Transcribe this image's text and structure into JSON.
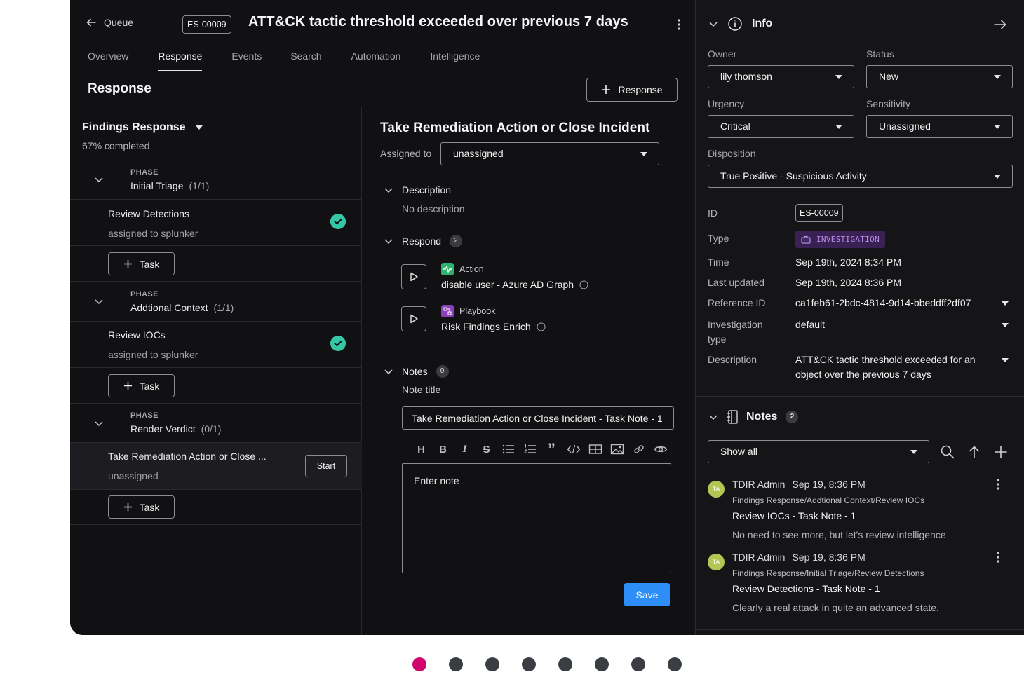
{
  "header": {
    "back_label": "Queue",
    "case_id": "ES-00009",
    "title": "ATT&CK tactic threshold exceeded over previous 7 days",
    "tabs": [
      {
        "label": "Overview"
      },
      {
        "label": "Response",
        "active": true
      },
      {
        "label": "Events"
      },
      {
        "label": "Search"
      },
      {
        "label": "Automation"
      },
      {
        "label": "Intelligence"
      }
    ]
  },
  "response": {
    "title": "Response",
    "add_button": "Response"
  },
  "findings": {
    "title": "Findings Response",
    "progress": "67% completed",
    "phases": [
      {
        "kicker": "PHASE",
        "name": "Initial Triage",
        "count": "(1/1)",
        "task": {
          "name": "Review Detections",
          "assignee": "assigned to splunker",
          "done": true
        }
      },
      {
        "kicker": "PHASE",
        "name": "Addtional Context",
        "count": "(1/1)",
        "task": {
          "name": "Review IOCs",
          "assignee": "assigned to splunker",
          "done": true
        }
      },
      {
        "kicker": "PHASE",
        "name": "Render Verdict",
        "count": "(0/1)",
        "task": {
          "name": "Take Remediation Action or Close ...",
          "assignee": "unassigned",
          "done": false,
          "start_label": "Start"
        }
      }
    ],
    "task_button": "Task"
  },
  "detail": {
    "title": "Take Remediation Action or Close Incident",
    "assigned_label": "Assigned to",
    "assigned_value": "unassigned",
    "description_head": "Description",
    "description_text": "No description",
    "respond_head": "Respond",
    "respond_count": "2",
    "actions": [
      {
        "kind": "Action",
        "name": "disable user - Azure AD Graph",
        "color": "#2fb36b"
      },
      {
        "kind": "Playbook",
        "name": "Risk Findings Enrich",
        "color": "#8b3fb8"
      }
    ],
    "notes_head": "Notes",
    "notes_count": "0",
    "note_title_label": "Note title",
    "note_title_value": "Take Remediation Action or Close Incident - Task Note - 1",
    "note_placeholder": "Enter note",
    "save_label": "Save",
    "toolbar_text": {
      "heading": "H",
      "bold": "B",
      "italic": "I",
      "strike": "S",
      "quote": "”"
    }
  },
  "info": {
    "title": "Info",
    "owner_label": "Owner",
    "owner_value": "lily thomson",
    "status_label": "Status",
    "status_value": "New",
    "urgency_label": "Urgency",
    "urgency_value": "Critical",
    "sensitivity_label": "Sensitivity",
    "sensitivity_value": "Unassigned",
    "disposition_label": "Disposition",
    "disposition_value": "True Positive - Suspicious Activity",
    "id_label": "ID",
    "id_value": "ES-00009",
    "type_label": "Type",
    "type_value": "INVESTIGATION",
    "time_label": "Time",
    "time_value": "Sep 19th, 2024 8:34 PM",
    "updated_label": "Last updated",
    "updated_value": "Sep 19th, 2024 8:36 PM",
    "ref_label": "Reference ID",
    "ref_value": "ca1feb61-2bdc-4814-9d14-bbeddff2df07",
    "inv_type_label_1": "Investigation",
    "inv_type_label_2": "type",
    "inv_type_value": "default",
    "desc_label": "Description",
    "desc_value_1": "ATT&CK tactic threshold exceeded for an",
    "desc_value_2": "object over the previous 7 days"
  },
  "notes_panel": {
    "title": "Notes",
    "count": "2",
    "filter_value": "Show all",
    "items": [
      {
        "initials": "TA",
        "author": "TDIR Admin",
        "time": "Sep 19, 8:36 PM",
        "path": "Findings Response/Addtional Context/Review IOCs",
        "title": "Review IOCs - Task Note - 1",
        "body": "No need to see more, but let's review intelligence"
      },
      {
        "initials": "TA",
        "author": "TDIR Admin",
        "time": "Sep 19, 8:36 PM",
        "path": "Findings Response/Initial Triage/Review Detections",
        "title": "Review Detections - Task Note - 1",
        "body": "Clearly a real attack in quite an advanced state."
      }
    ]
  },
  "pager": {
    "count": 8,
    "active_index": 0,
    "active_color": "#d1066c"
  }
}
